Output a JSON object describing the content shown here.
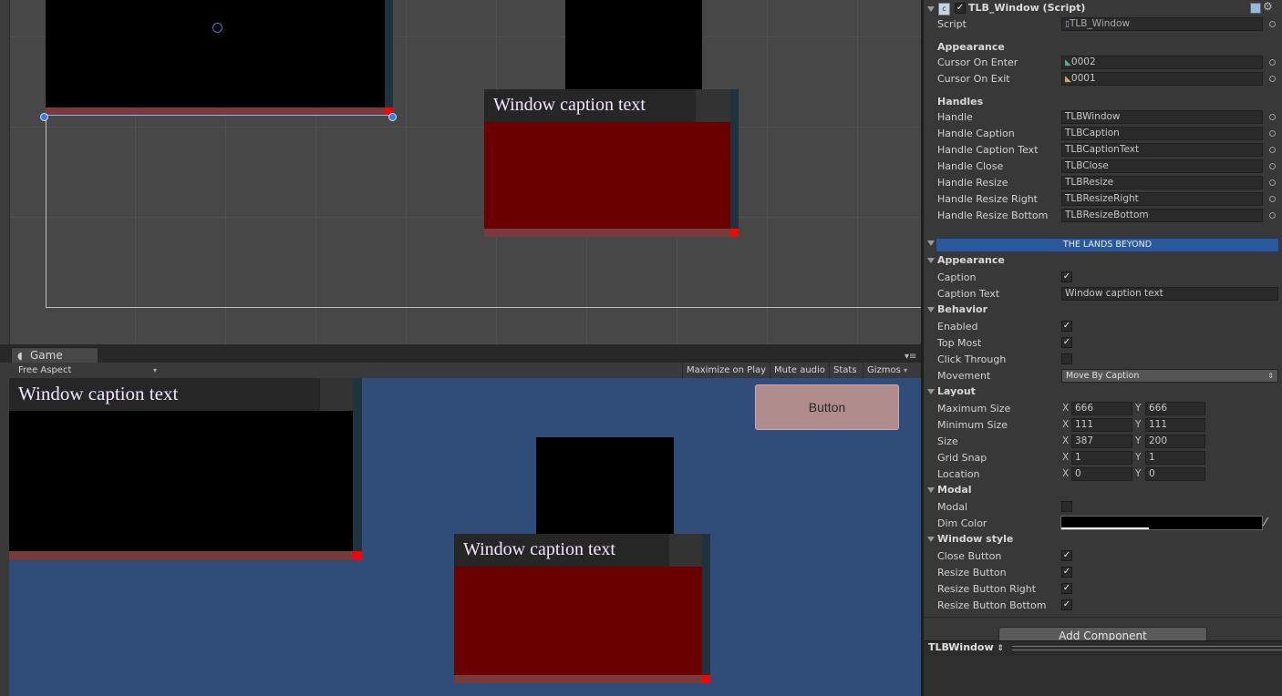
{
  "scene": {
    "windows": [
      {
        "caption": "Window caption text"
      }
    ]
  },
  "game": {
    "tab_label": "Game",
    "aspect": "Free Aspect",
    "toolbar": {
      "maximize": "Maximize on Play",
      "mute": "Mute audio",
      "stats": "Stats",
      "gizmos": "Gizmos"
    },
    "windows": [
      {
        "caption": "Window caption text"
      },
      {
        "caption": "Window caption text"
      }
    ],
    "button_label": "Button"
  },
  "inspector": {
    "component_title": "TLB_Window (Script)",
    "script_label": "Script",
    "script_value": "TLB_Window",
    "appearance_header": "Appearance",
    "cursor_enter_label": "Cursor On Enter",
    "cursor_enter_value": "0002",
    "cursor_exit_label": "Cursor On Exit",
    "cursor_exit_value": "0001",
    "handles_header": "Handles",
    "handles": [
      {
        "label": "Handle",
        "value": "TLBWindow"
      },
      {
        "label": "Handle Caption",
        "value": "TLBCaption"
      },
      {
        "label": "Handle Caption Text",
        "value": "TLBCaptionText"
      },
      {
        "label": "Handle Close",
        "value": "TLBClose"
      },
      {
        "label": "Handle Resize",
        "value": "TLBResize"
      },
      {
        "label": "Handle Resize Right",
        "value": "TLBResizeRight"
      },
      {
        "label": "Handle Resize Bottom",
        "value": "TLBResizeBottom"
      }
    ],
    "banner": "THE LANDS BEYOND",
    "appearance2_header": "Appearance",
    "caption_label": "Caption",
    "caption_text_label": "Caption Text",
    "caption_text_value": "Window caption text",
    "behavior_header": "Behavior",
    "enabled_label": "Enabled",
    "top_most_label": "Top Most",
    "click_through_label": "Click Through",
    "movement_label": "Movement",
    "movement_value": "Move By Caption",
    "layout_header": "Layout",
    "layout_rows": [
      {
        "label": "Maximum Size",
        "x": "666",
        "y": "666"
      },
      {
        "label": "Minimum Size",
        "x": "111",
        "y": "111"
      },
      {
        "label": "Size",
        "x": "387",
        "y": "200"
      },
      {
        "label": "Grid Snap",
        "x": "1",
        "y": "1"
      },
      {
        "label": "Location",
        "x": "0",
        "y": "0"
      }
    ],
    "axis_x": "X",
    "axis_y": "Y",
    "modal_header": "Modal",
    "modal_label": "Modal",
    "dim_color_label": "Dim Color",
    "window_style_header": "Window style",
    "close_button_label": "Close Button",
    "resize_button_label": "Resize Button",
    "resize_right_label": "Resize Button Right",
    "resize_bottom_label": "Resize Button Bottom",
    "add_component": "Add Component",
    "footer_object": "TLBWindow"
  },
  "checkmark": "✓",
  "colors": {
    "window_body": "#6b0000",
    "window_dark": "#000000",
    "caption_bar": "#262626",
    "resize_bar": "#7a3a3a",
    "resize_corner": "#ff0000",
    "game_bg": "#304c78",
    "banner": "#2a5898",
    "ui_button": "#b08c8c"
  }
}
